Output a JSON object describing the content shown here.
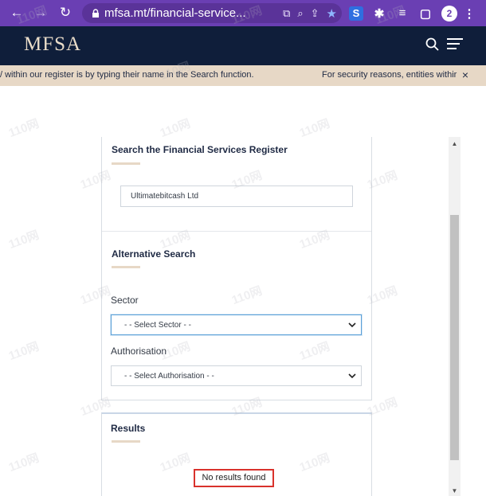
{
  "browser": {
    "url": "mfsa.mt/financial-service...",
    "avatar_letter": "2"
  },
  "site": {
    "logo": "MFSA"
  },
  "banner": {
    "text_left": "/ within our register is by typing their name in the Search function.",
    "text_right": "For security reasons, entities withir"
  },
  "register_search": {
    "title": "Search the Financial Services Register",
    "value": "Ultimatebitcash Ltd"
  },
  "alt_search": {
    "title": "Alternative Search",
    "sector_label": "Sector",
    "sector_value": "- - Select Sector - -",
    "authorisation_label": "Authorisation",
    "authorisation_value": "- - Select Authorisation - -"
  },
  "results": {
    "title": "Results",
    "message": "No results found"
  },
  "watermark": "110网"
}
